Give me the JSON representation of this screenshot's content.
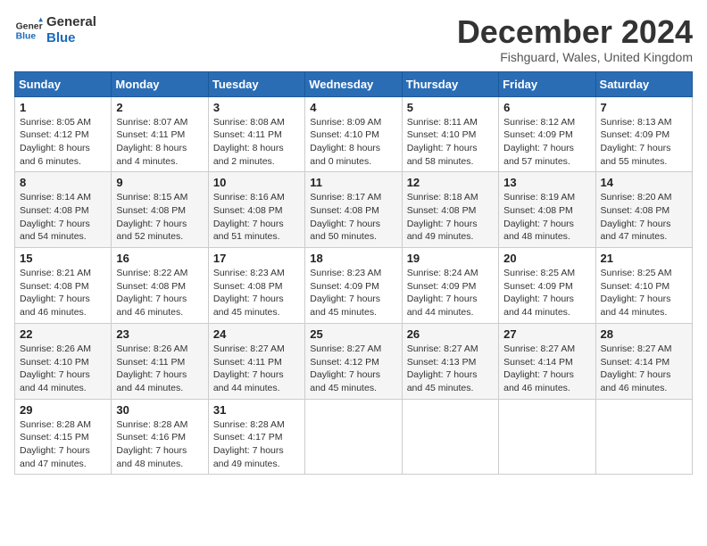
{
  "header": {
    "logo_general": "General",
    "logo_blue": "Blue",
    "month_title": "December 2024",
    "subtitle": "Fishguard, Wales, United Kingdom"
  },
  "days_of_week": [
    "Sunday",
    "Monday",
    "Tuesday",
    "Wednesday",
    "Thursday",
    "Friday",
    "Saturday"
  ],
  "weeks": [
    [
      {
        "day": "1",
        "sunrise": "8:05 AM",
        "sunset": "4:12 PM",
        "daylight": "8 hours and 6 minutes."
      },
      {
        "day": "2",
        "sunrise": "8:07 AM",
        "sunset": "4:11 PM",
        "daylight": "8 hours and 4 minutes."
      },
      {
        "day": "3",
        "sunrise": "8:08 AM",
        "sunset": "4:11 PM",
        "daylight": "8 hours and 2 minutes."
      },
      {
        "day": "4",
        "sunrise": "8:09 AM",
        "sunset": "4:10 PM",
        "daylight": "8 hours and 0 minutes."
      },
      {
        "day": "5",
        "sunrise": "8:11 AM",
        "sunset": "4:10 PM",
        "daylight": "7 hours and 58 minutes."
      },
      {
        "day": "6",
        "sunrise": "8:12 AM",
        "sunset": "4:09 PM",
        "daylight": "7 hours and 57 minutes."
      },
      {
        "day": "7",
        "sunrise": "8:13 AM",
        "sunset": "4:09 PM",
        "daylight": "7 hours and 55 minutes."
      }
    ],
    [
      {
        "day": "8",
        "sunrise": "8:14 AM",
        "sunset": "4:08 PM",
        "daylight": "7 hours and 54 minutes."
      },
      {
        "day": "9",
        "sunrise": "8:15 AM",
        "sunset": "4:08 PM",
        "daylight": "7 hours and 52 minutes."
      },
      {
        "day": "10",
        "sunrise": "8:16 AM",
        "sunset": "4:08 PM",
        "daylight": "7 hours and 51 minutes."
      },
      {
        "day": "11",
        "sunrise": "8:17 AM",
        "sunset": "4:08 PM",
        "daylight": "7 hours and 50 minutes."
      },
      {
        "day": "12",
        "sunrise": "8:18 AM",
        "sunset": "4:08 PM",
        "daylight": "7 hours and 49 minutes."
      },
      {
        "day": "13",
        "sunrise": "8:19 AM",
        "sunset": "4:08 PM",
        "daylight": "7 hours and 48 minutes."
      },
      {
        "day": "14",
        "sunrise": "8:20 AM",
        "sunset": "4:08 PM",
        "daylight": "7 hours and 47 minutes."
      }
    ],
    [
      {
        "day": "15",
        "sunrise": "8:21 AM",
        "sunset": "4:08 PM",
        "daylight": "7 hours and 46 minutes."
      },
      {
        "day": "16",
        "sunrise": "8:22 AM",
        "sunset": "4:08 PM",
        "daylight": "7 hours and 46 minutes."
      },
      {
        "day": "17",
        "sunrise": "8:23 AM",
        "sunset": "4:08 PM",
        "daylight": "7 hours and 45 minutes."
      },
      {
        "day": "18",
        "sunrise": "8:23 AM",
        "sunset": "4:09 PM",
        "daylight": "7 hours and 45 minutes."
      },
      {
        "day": "19",
        "sunrise": "8:24 AM",
        "sunset": "4:09 PM",
        "daylight": "7 hours and 44 minutes."
      },
      {
        "day": "20",
        "sunrise": "8:25 AM",
        "sunset": "4:09 PM",
        "daylight": "7 hours and 44 minutes."
      },
      {
        "day": "21",
        "sunrise": "8:25 AM",
        "sunset": "4:10 PM",
        "daylight": "7 hours and 44 minutes."
      }
    ],
    [
      {
        "day": "22",
        "sunrise": "8:26 AM",
        "sunset": "4:10 PM",
        "daylight": "7 hours and 44 minutes."
      },
      {
        "day": "23",
        "sunrise": "8:26 AM",
        "sunset": "4:11 PM",
        "daylight": "7 hours and 44 minutes."
      },
      {
        "day": "24",
        "sunrise": "8:27 AM",
        "sunset": "4:11 PM",
        "daylight": "7 hours and 44 minutes."
      },
      {
        "day": "25",
        "sunrise": "8:27 AM",
        "sunset": "4:12 PM",
        "daylight": "7 hours and 45 minutes."
      },
      {
        "day": "26",
        "sunrise": "8:27 AM",
        "sunset": "4:13 PM",
        "daylight": "7 hours and 45 minutes."
      },
      {
        "day": "27",
        "sunrise": "8:27 AM",
        "sunset": "4:14 PM",
        "daylight": "7 hours and 46 minutes."
      },
      {
        "day": "28",
        "sunrise": "8:27 AM",
        "sunset": "4:14 PM",
        "daylight": "7 hours and 46 minutes."
      }
    ],
    [
      {
        "day": "29",
        "sunrise": "8:28 AM",
        "sunset": "4:15 PM",
        "daylight": "7 hours and 47 minutes."
      },
      {
        "day": "30",
        "sunrise": "8:28 AM",
        "sunset": "4:16 PM",
        "daylight": "7 hours and 48 minutes."
      },
      {
        "day": "31",
        "sunrise": "8:28 AM",
        "sunset": "4:17 PM",
        "daylight": "7 hours and 49 minutes."
      },
      null,
      null,
      null,
      null
    ]
  ],
  "labels": {
    "sunrise": "Sunrise:",
    "sunset": "Sunset:",
    "daylight": "Daylight:"
  }
}
